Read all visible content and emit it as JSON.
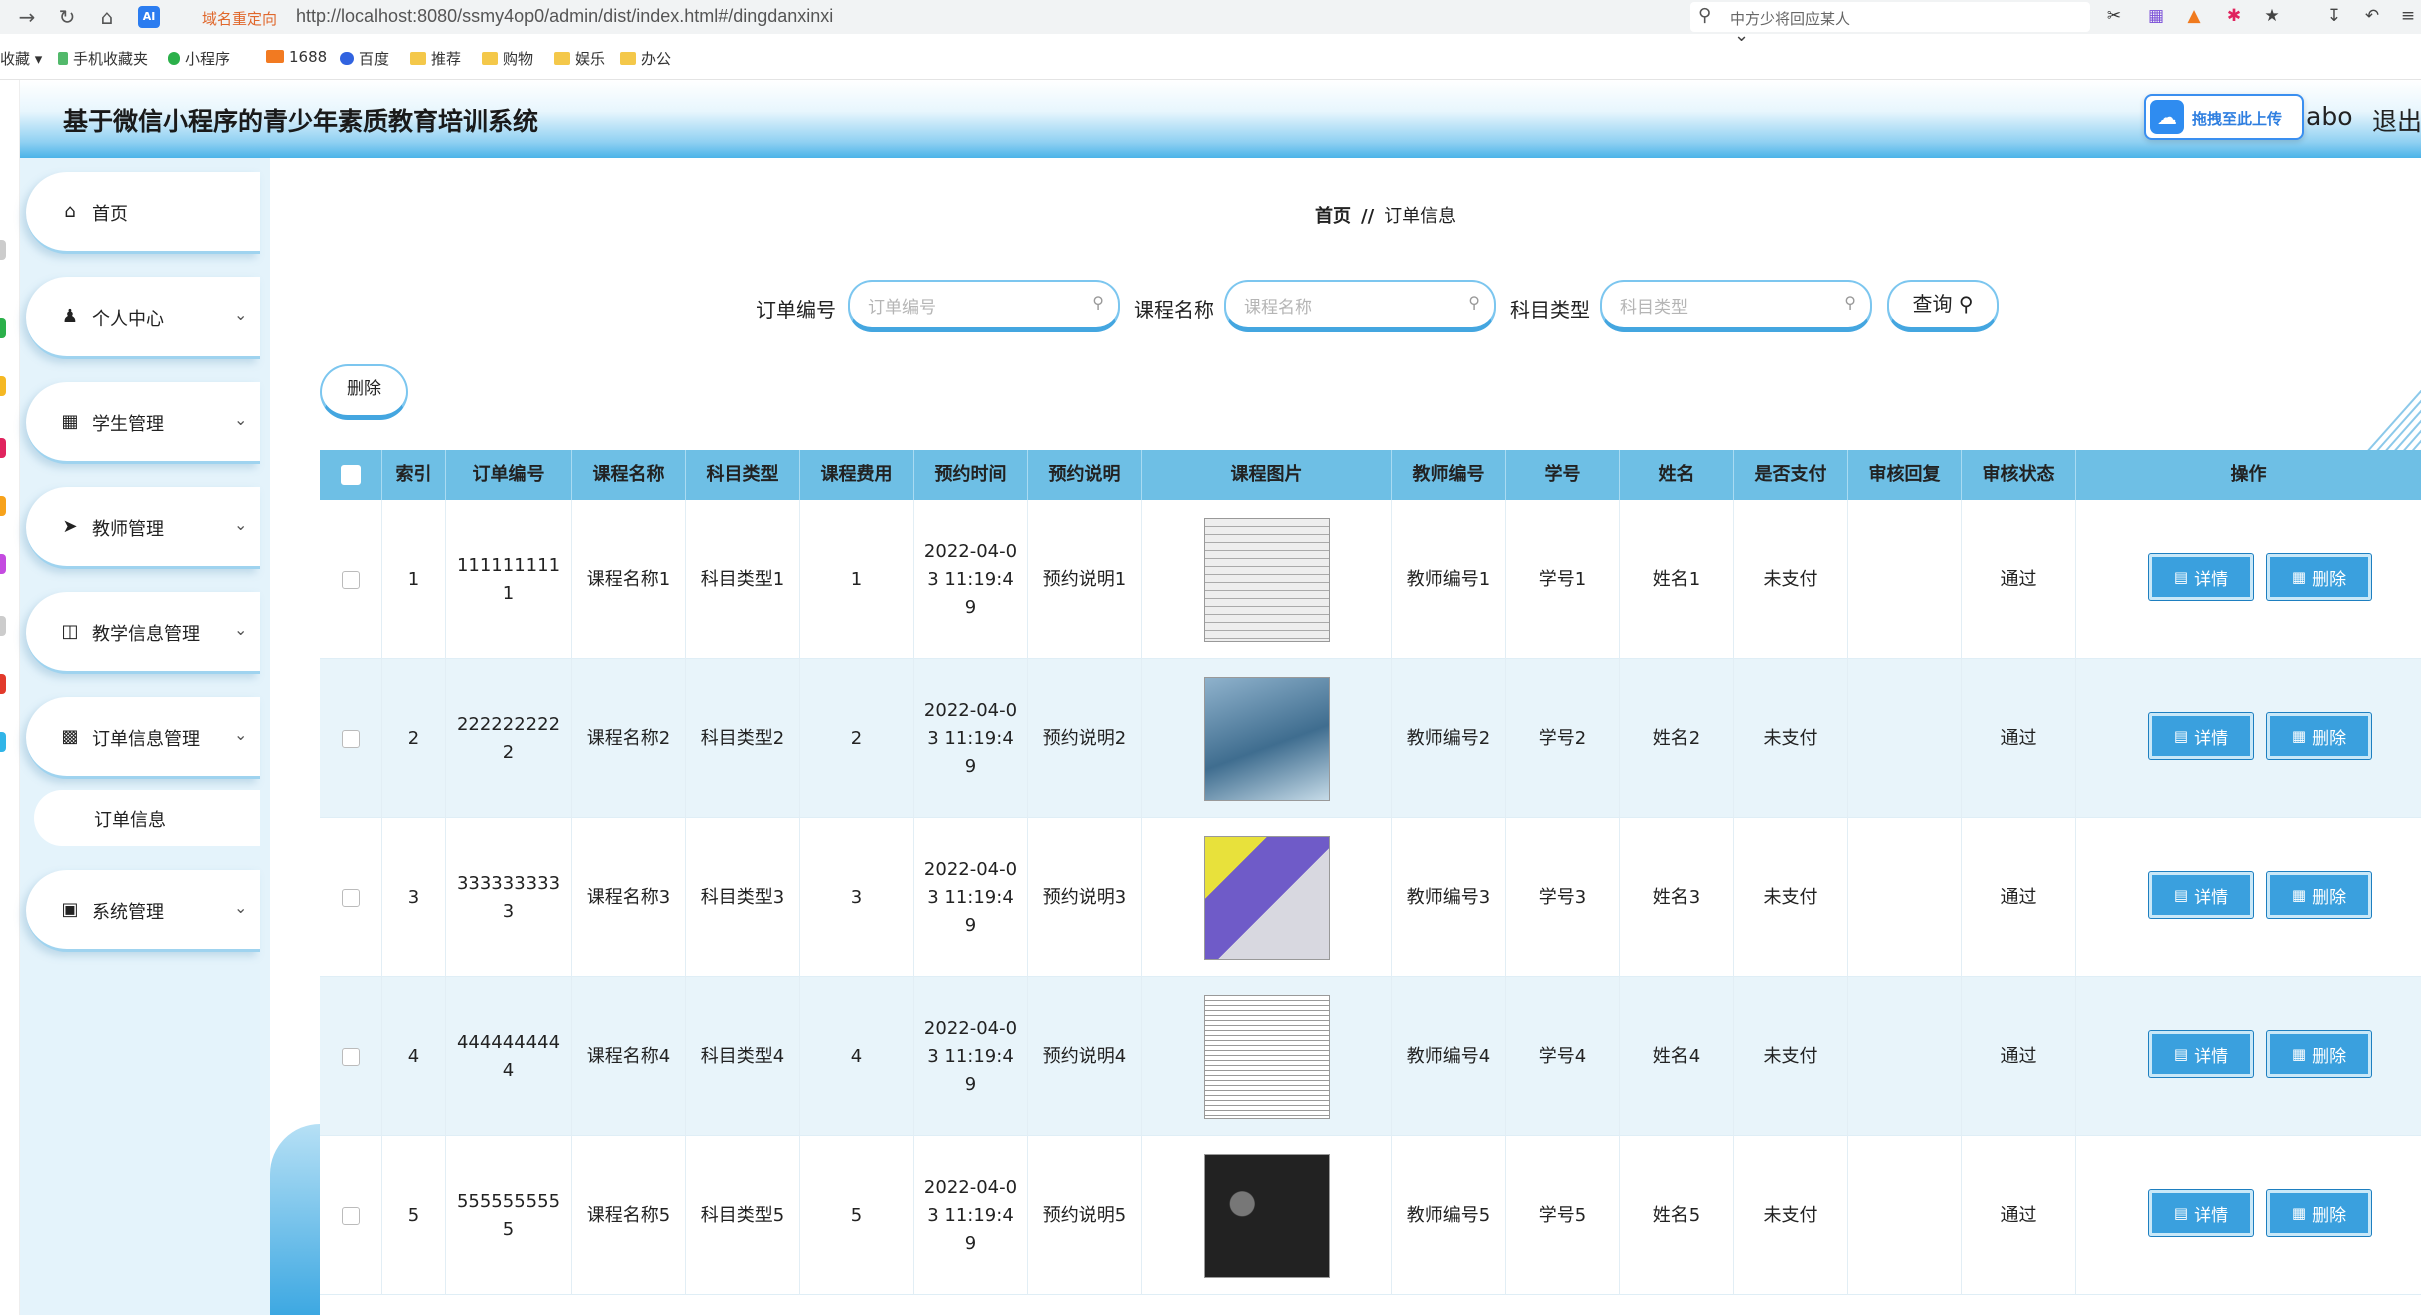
{
  "browser": {
    "redirect_tag": "域名重定向",
    "url": "http://localhost:8080/ssmy4op0/admin/dist/index.html#/dingdanxinxi",
    "search_text": "中方少将回应某人",
    "ai_badge": "AI",
    "bookmarks": [
      "收藏",
      "手机收藏夹",
      "小程序",
      "1688",
      "百度",
      "推荐",
      "购物",
      "娱乐",
      "办公"
    ]
  },
  "header": {
    "title": "基于微信小程序的青少年素质教育培训系统",
    "upload_label": "拖拽至此上传",
    "user_name": "abo",
    "logout_label": "退出登"
  },
  "sidebar": {
    "items": [
      {
        "label": "首页",
        "icon": "home-icon"
      },
      {
        "label": "个人中心",
        "icon": "user-icon"
      },
      {
        "label": "学生管理",
        "icon": "grid-icon"
      },
      {
        "label": "教师管理",
        "icon": "send-icon"
      },
      {
        "label": "教学信息管理",
        "icon": "briefcase-icon"
      },
      {
        "label": "订单信息管理",
        "icon": "chart-icon"
      },
      {
        "label": "系统管理",
        "icon": "cart-icon"
      }
    ],
    "sub_item": "订单信息"
  },
  "breadcrumb": {
    "home": "首页",
    "sep": "//",
    "current": "订单信息"
  },
  "filters": [
    {
      "label": "订单编号",
      "placeholder": "订单编号"
    },
    {
      "label": "课程名称",
      "placeholder": "课程名称"
    },
    {
      "label": "科目类型",
      "placeholder": "科目类型"
    }
  ],
  "query_label": "查询",
  "delete_label": "删除",
  "table": {
    "headers": [
      "索引",
      "订单编号",
      "课程名称",
      "科目类型",
      "课程费用",
      "预约时间",
      "预约说明",
      "课程图片",
      "教师编号",
      "学号",
      "姓名",
      "是否支付",
      "审核回复",
      "审核状态",
      "操作"
    ],
    "detail_label": "详情",
    "delete_label": "删除",
    "rows": [
      {
        "idx": "1",
        "order_no": "1111111111",
        "course": "课程名称1",
        "subject": "科目类型1",
        "fee": "1",
        "time": "2022-04-03 11:19:49",
        "note": "预约说明1",
        "teacher": "教师编号1",
        "student_no": "学号1",
        "name": "姓名1",
        "paid": "未支付",
        "reply": "",
        "status": "通过"
      },
      {
        "idx": "2",
        "order_no": "2222222222",
        "course": "课程名称2",
        "subject": "科目类型2",
        "fee": "2",
        "time": "2022-04-03 11:19:49",
        "note": "预约说明2",
        "teacher": "教师编号2",
        "student_no": "学号2",
        "name": "姓名2",
        "paid": "未支付",
        "reply": "",
        "status": "通过"
      },
      {
        "idx": "3",
        "order_no": "3333333333",
        "course": "课程名称3",
        "subject": "科目类型3",
        "fee": "3",
        "time": "2022-04-03 11:19:49",
        "note": "预约说明3",
        "teacher": "教师编号3",
        "student_no": "学号3",
        "name": "姓名3",
        "paid": "未支付",
        "reply": "",
        "status": "通过"
      },
      {
        "idx": "4",
        "order_no": "4444444444",
        "course": "课程名称4",
        "subject": "科目类型4",
        "fee": "4",
        "time": "2022-04-03 11:19:49",
        "note": "预约说明4",
        "teacher": "教师编号4",
        "student_no": "学号4",
        "name": "姓名4",
        "paid": "未支付",
        "reply": "",
        "status": "通过"
      },
      {
        "idx": "5",
        "order_no": "5555555555",
        "course": "课程名称5",
        "subject": "科目类型5",
        "fee": "5",
        "time": "2022-04-03 11:19:49",
        "note": "预约说明5",
        "teacher": "教师编号5",
        "student_no": "学号5",
        "name": "姓名5",
        "paid": "未支付",
        "reply": "",
        "status": "通过"
      }
    ]
  }
}
